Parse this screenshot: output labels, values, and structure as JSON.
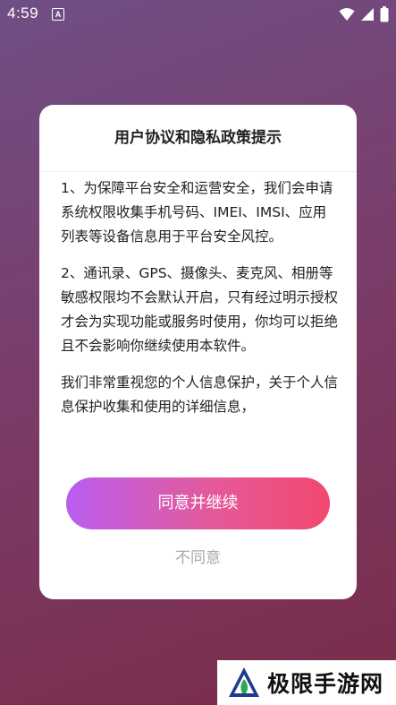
{
  "status_bar": {
    "time": "4:59",
    "app_icon_letter": "A"
  },
  "dialog": {
    "title": "用户协议和隐私政策提示",
    "paragraphs": [
      "1、为保障平台安全和运营安全，我们会申请系统权限收集手机号码、IMEI、IMSI、应用列表等设备信息用于平台安全风控。",
      "2、通讯录、GPS、摄像头、麦克风、相册等敏感权限均不会默认开启，只有经过明示授权才会为实现功能或服务时使用，你均可以拒绝且不会影响你继续使用本软件。",
      "我们非常重视您的个人信息保护，关于个人信息保护收集和使用的详细信息，"
    ],
    "agree_label": "同意并继续",
    "disagree_label": "不同意"
  },
  "watermark": {
    "text": "极限手游网"
  },
  "colors": {
    "agree_gradient_start": "#b95ef0",
    "agree_gradient_end": "#f2486f",
    "disagree_text": "#a8a8a8"
  },
  "icons": [
    "wifi-icon",
    "signal-icon",
    "battery-icon",
    "app-notification-icon"
  ]
}
